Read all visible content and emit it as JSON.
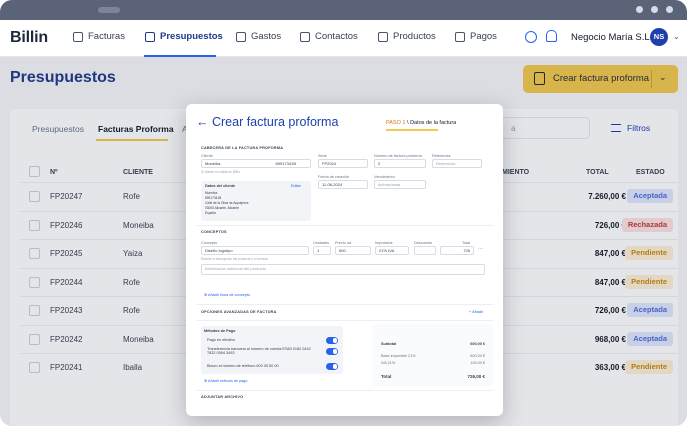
{
  "nav": {
    "logo": "Billin",
    "items": [
      "Facturas",
      "Presupuestos",
      "Gastos",
      "Contactos",
      "Productos",
      "Pagos"
    ],
    "business": "Negocio María S.L.",
    "avatar": "NS"
  },
  "page": {
    "title": "Presupuestos",
    "cta": "Crear factura proforma"
  },
  "tabs": [
    "Presupuestos",
    "Facturas Proforma",
    "A"
  ],
  "filters_label": "Filtros",
  "search_placeholder": "a",
  "table": {
    "headers": {
      "num": "Nº",
      "client": "CLIENTE",
      "due": "MIENTO",
      "total": "TOTAL",
      "status": "ESTADO"
    },
    "rows": [
      {
        "num": "FP20247",
        "client": "Rofe",
        "total": "7.260,00 €",
        "status": "Aceptada"
      },
      {
        "num": "FP20246",
        "client": "Moneiba",
        "total": "726,00 €",
        "status": "Rechazada"
      },
      {
        "num": "FP20245",
        "client": "Yaiza",
        "total": "847,00 €",
        "status": "Pendiente"
      },
      {
        "num": "FP20244",
        "client": "Rofe",
        "total": "847,00 €",
        "status": "Pendiente"
      },
      {
        "num": "FP20243",
        "client": "Rofe",
        "total": "726,00 €",
        "status": "Aceptada"
      },
      {
        "num": "FP20242",
        "client": "Moneiba",
        "total": "968,00 €",
        "status": "Aceptada"
      },
      {
        "num": "FP20241",
        "client": "Iballa",
        "total": "363,00 €",
        "status": "Pendiente"
      }
    ]
  },
  "status_colors": {
    "Aceptada": {
      "bg": "#e0e7ff",
      "fg": "#4f6bd8"
    },
    "Rechazada": {
      "bg": "#fde2e2",
      "fg": "#c03939"
    },
    "Pendiente": {
      "bg": "#fdf0d5",
      "fg": "#c58a12"
    }
  },
  "modal": {
    "title": "Crear factura proforma",
    "step_prefix": "PASO 1",
    "step_label": "Datos de la factura",
    "sec_header": "CABECERA DE LA FACTURA PROFORMA",
    "client_label": "Cliente",
    "client_value": "Moneiba",
    "client_id": "89917341B",
    "client_hint": "Sí cliente es valida en Billin",
    "serie_label": "Serie",
    "serie_value": "FP2024",
    "numero_label": "Número de factura proforma",
    "numero_value": "2",
    "ref_label": "Referencia",
    "ref_placeholder": "Referencia",
    "fecha_label": "Fecha de creación",
    "fecha_value": "11-06-2024",
    "venc_label": "Vencimiento",
    "venc_placeholder": "dd/mm/aaaa",
    "client_data_title": "Datos del cliente",
    "edit_label": "Editar",
    "client_data_lines": [
      "Moneiba",
      "89917341B",
      "Calle de la Oliva de Alquejeros",
      "03005 Alicante, Alicante",
      "España"
    ],
    "concepts_header": "CONCEPTOS",
    "concept_label": "Concepto",
    "concept_value": "Diseño logotipo",
    "units_label": "Unidades",
    "units_value": "1",
    "price_label": "Precio ud.",
    "price_value": "600",
    "taxes_label": "Impuestos",
    "taxes_value": "21% IVA",
    "disc_label": "Descuento",
    "total_label": "Total",
    "total_value": "726",
    "concept_hint": "Escribe la descripción del producto o el servicio",
    "extra_info_placeholder": "Información adicional del producto",
    "add_line": "Añadir línea de concepto",
    "advanced": "OPCIONES AVANZADAS DE FACTURA",
    "more": "+ Añadir",
    "payments_title": "Métodos de Pago",
    "payments": [
      "Pago en efectivo",
      "Transferencia bancaria al número de cuenta ES83 0182 0442 7832 0564 3493",
      "Bizum al número de teléfono 600 05 50 00"
    ],
    "add_payment": "Añadir método de pago",
    "summary": [
      {
        "label": "Subtotal",
        "value": "600,00 €"
      },
      {
        "label": "Base imponible 21%",
        "value": "600,00 €"
      },
      {
        "label": "IVA 21%",
        "value": "126,00 €"
      }
    ],
    "summary_total_label": "Total",
    "summary_total_value": "726,00 €",
    "attach_label": "ADJUNTAR ARCHIVO"
  }
}
